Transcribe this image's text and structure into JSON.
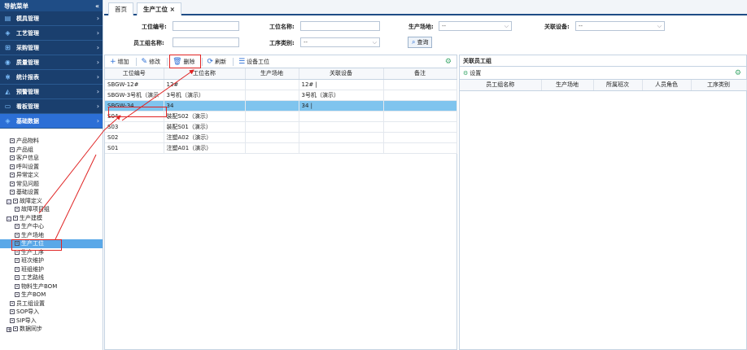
{
  "sidebar": {
    "title": "导航菜单",
    "collapse": "«",
    "modules": [
      {
        "label": "模具管理",
        "icon": "▤"
      },
      {
        "label": "工艺管理",
        "icon": "◈"
      },
      {
        "label": "采购管理",
        "icon": "⊞"
      },
      {
        "label": "质量管理",
        "icon": "◉"
      },
      {
        "label": "统计报表",
        "icon": "⋇"
      },
      {
        "label": "预警管理",
        "icon": "◭"
      },
      {
        "label": "看板管理",
        "icon": "▭"
      },
      {
        "label": "基础数据",
        "icon": "◈"
      }
    ],
    "tree": [
      "产品物料",
      "产品组",
      "客户信息",
      "呼叫设置",
      "异常定义",
      "常见问题",
      "基础设置",
      "故障定义",
      "故障项目组",
      "生产建模",
      "生产中心",
      "生产场地",
      "生产工位",
      "生产工序",
      "班次维护",
      "班组维护",
      "工艺路线",
      "物料生产BOM",
      "生产BOM",
      "员工组设置",
      "SOP导入",
      "SIP导入",
      "数据同步"
    ]
  },
  "tabs": {
    "home": "首页",
    "current": "生产工位",
    "close": "×"
  },
  "filter": {
    "station_code_label": "工位编号:",
    "station_name_label": "工位名称:",
    "site_label": "生产场地:",
    "site_value": "--",
    "device_label": "关联设备:",
    "device_value": "--",
    "group_name_label": "员工组名称:",
    "type_label": "工序类别:",
    "type_value": "--",
    "query": "查询"
  },
  "toolbar": {
    "add": "增加",
    "edit": "修改",
    "delete": "删除",
    "refresh": "刷新",
    "device": "设备工位"
  },
  "grid": {
    "columns": [
      "工位编号",
      "工位名称",
      "生产场地",
      "关联设备",
      "备注"
    ],
    "rows": [
      [
        "SBGW-12#",
        "12#",
        "",
        "12# |",
        ""
      ],
      [
        "SBGW-3号机（演示",
        "3号机（演示）",
        "",
        "3号机（演示）",
        ""
      ],
      [
        "SBGW-34",
        "34",
        "",
        "34 |",
        ""
      ],
      [
        "S04",
        "装配S02（演示）",
        "",
        "",
        ""
      ],
      [
        "S03",
        "装配S01（演示）",
        "",
        "",
        ""
      ],
      [
        "S02",
        "注塑A02（演示）",
        "",
        "",
        ""
      ],
      [
        "S01",
        "注塑A01（演示）",
        "",
        "",
        ""
      ]
    ]
  },
  "right": {
    "title": "关联员工组",
    "settings": "设置",
    "columns": [
      "员工组名称",
      "生产场地",
      "所属班次",
      "人员角色",
      "工序类别"
    ]
  }
}
